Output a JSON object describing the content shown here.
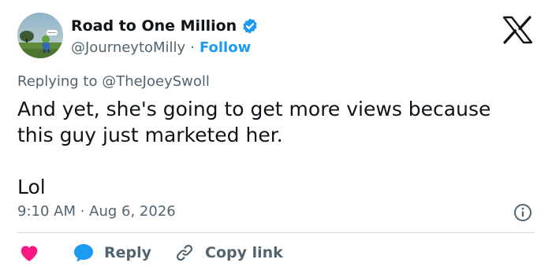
{
  "author": {
    "display_name": "Road to One Million",
    "handle": "@JourneytoMilly",
    "separator": "·",
    "follow_label": "Follow"
  },
  "reply": {
    "prefix": "Replying to ",
    "mention": "@TheJoeySwoll"
  },
  "tweet": {
    "line1": "And yet, she's going to get more views because",
    "line2": "this guy just marketed her.",
    "line3": "Lol"
  },
  "meta": {
    "timestamp": "9:10 AM · Aug 6, 2026"
  },
  "actions": {
    "reply_label": "Reply",
    "copy_link_label": "Copy link"
  },
  "icons": {
    "verified": "verified-badge-icon",
    "logo": "x-logo-icon",
    "info": "info-icon",
    "like": "heart-icon",
    "reply": "speech-bubble-icon",
    "copy_link": "link-icon"
  },
  "colors": {
    "text": "#0f1419",
    "secondary": "#536471",
    "accent": "#1d9bf0",
    "like": "#f91880",
    "divider": "#cfd9de"
  }
}
